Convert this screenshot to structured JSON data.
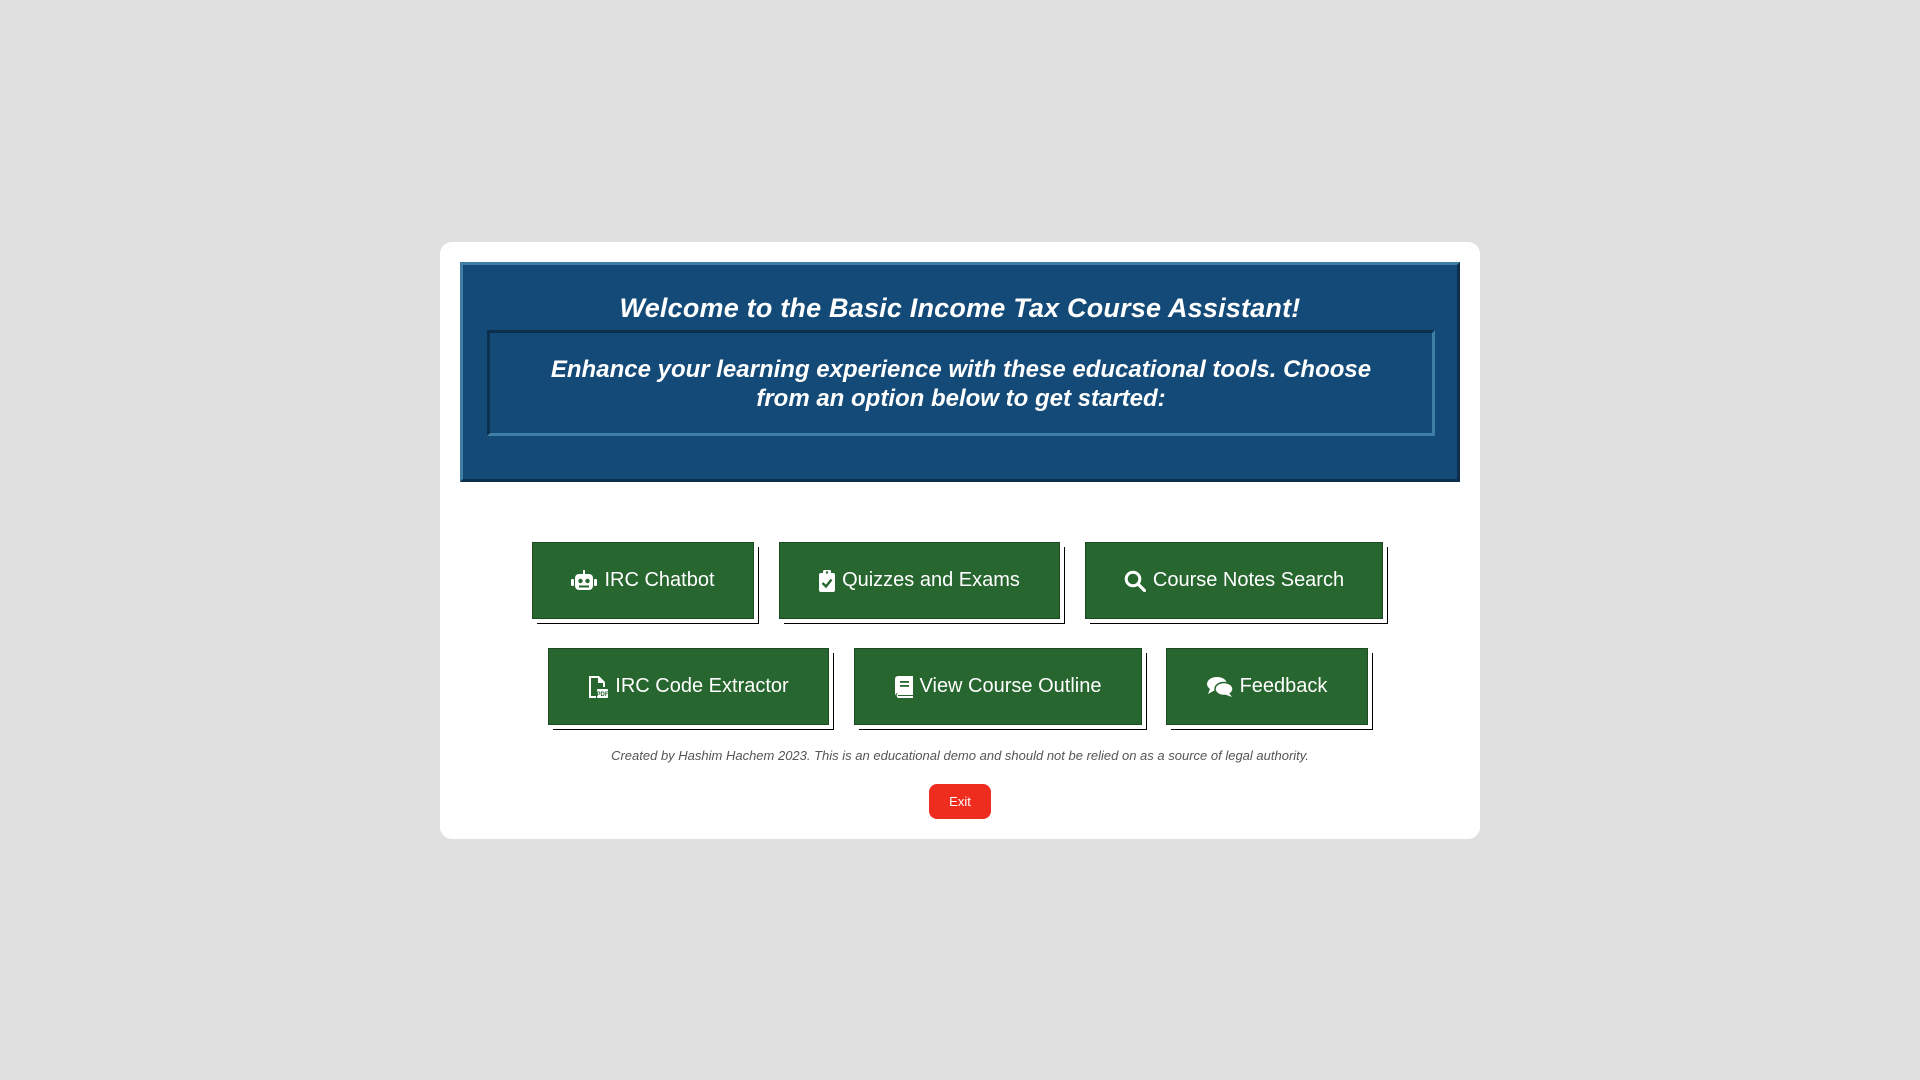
{
  "banner": {
    "title": "Welcome to the Basic Income Tax Course Assistant!",
    "subtitle": "Enhance your learning experience with these educational tools. Choose from an option below to get started:"
  },
  "buttons": [
    {
      "label": "IRC Chatbot",
      "icon": "robot-icon"
    },
    {
      "label": "Quizzes and Exams",
      "icon": "clipboard-check-icon"
    },
    {
      "label": "Course Notes Search",
      "icon": "search-icon"
    },
    {
      "label": "IRC Code Extractor",
      "icon": "file-pdf-icon"
    },
    {
      "label": "View Course Outline",
      "icon": "book-icon"
    },
    {
      "label": "Feedback",
      "icon": "comments-icon"
    }
  ],
  "footer": {
    "note": "Created by Hashim Hachem 2023. This is an educational demo and should not be relied on as a source of legal authority."
  },
  "exit": {
    "label": "Exit"
  },
  "colors": {
    "background": "#e0e0e0",
    "banner": "#134a77",
    "button": "#27662f",
    "exit": "#ee2d1f"
  }
}
